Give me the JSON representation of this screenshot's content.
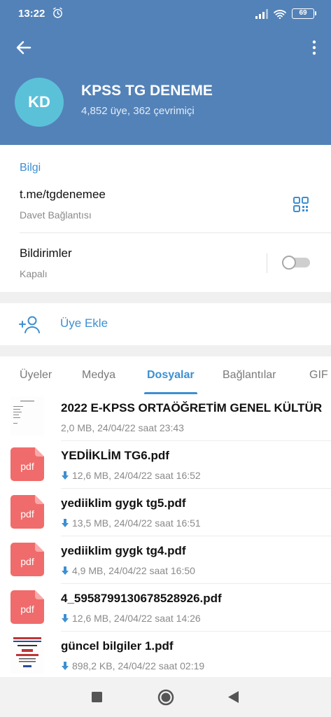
{
  "status": {
    "time": "13:22",
    "battery": "69"
  },
  "group": {
    "avatar_initials": "KD",
    "name": "KPSS TG DENEME",
    "subtitle": "4,852 üye, 362 çevrimiçi"
  },
  "info": {
    "section_label": "Bilgi",
    "link": "t.me/tgdenemee",
    "link_label": "Davet Bağlantısı",
    "notifications_label": "Bildirimler",
    "notifications_state": "Kapalı"
  },
  "add_member": {
    "label": "Üye Ekle"
  },
  "tabs": [
    {
      "label": "Üyeler"
    },
    {
      "label": "Medya"
    },
    {
      "label": "Dosyalar"
    },
    {
      "label": "Bağlantılar"
    },
    {
      "label": "GIF"
    }
  ],
  "files": [
    {
      "name": "2022 E-KPSS ORTAÖĞRETİM GENEL KÜLTÜR",
      "meta": "2,0 MB, 24/04/22 saat 23:43",
      "thumb": "document"
    },
    {
      "name": "YEDİİKLİM TG6.pdf",
      "meta": "12,6 MB, 24/04/22 saat 16:52",
      "thumb": "pdf"
    },
    {
      "name": "yediiklim gygk tg5.pdf",
      "meta": "13,5 MB, 24/04/22 saat 16:51",
      "thumb": "pdf"
    },
    {
      "name": "yediiklim gygk tg4.pdf",
      "meta": "4,9 MB, 24/04/22 saat 16:50",
      "thumb": "pdf"
    },
    {
      "name": "4_5958799130678528926.pdf",
      "meta": "12,6 MB, 24/04/22 saat 14:26",
      "thumb": "pdf"
    },
    {
      "name": "güncel bilgiler 1.pdf",
      "meta": "898,2 KB, 24/04/22 saat 02:19",
      "thumb": "document"
    }
  ],
  "pdf_label": "pdf",
  "colors": {
    "header": "#5382b8",
    "accent": "#3d8fd2",
    "avatar": "#5bc1d9",
    "pdf": "#f06b6b"
  }
}
